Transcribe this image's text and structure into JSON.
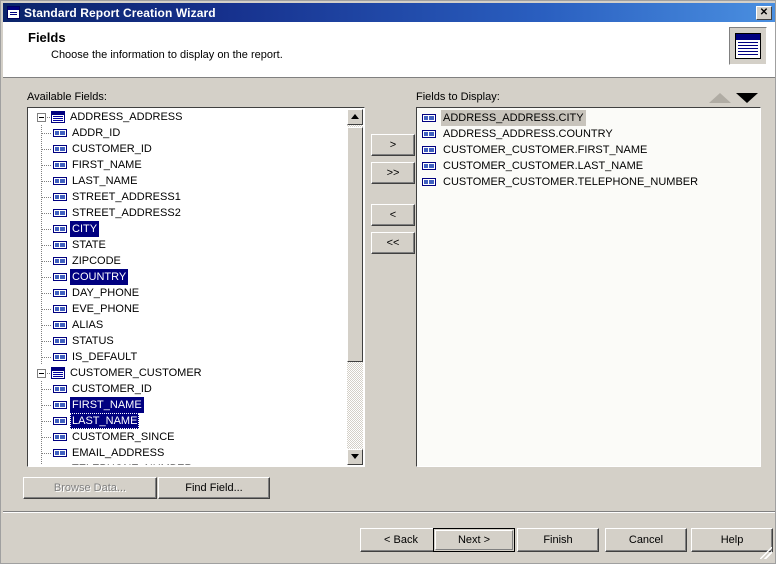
{
  "window": {
    "title": "Standard Report Creation Wizard",
    "icon": "report-wizard-icon",
    "close_label": "✕"
  },
  "header": {
    "title": "Fields",
    "subtitle": "Choose the information to display on the report.",
    "icon": "fields-page-icon"
  },
  "panels": {
    "available_label": "Available Fields:",
    "display_label": "Fields to Display:"
  },
  "sort": {
    "up_icon": "sort-up-arrow",
    "down_icon": "sort-down-arrow"
  },
  "tree": [
    {
      "type": "table",
      "label": "ADDRESS_ADDRESS",
      "selected": false
    },
    {
      "type": "field",
      "label": "ADDR_ID",
      "selected": false
    },
    {
      "type": "field",
      "label": "CUSTOMER_ID",
      "selected": false
    },
    {
      "type": "field",
      "label": "FIRST_NAME",
      "selected": false
    },
    {
      "type": "field",
      "label": "LAST_NAME",
      "selected": false
    },
    {
      "type": "field",
      "label": "STREET_ADDRESS1",
      "selected": false
    },
    {
      "type": "field",
      "label": "STREET_ADDRESS2",
      "selected": false
    },
    {
      "type": "field",
      "label": "CITY",
      "selected": true
    },
    {
      "type": "field",
      "label": "STATE",
      "selected": false
    },
    {
      "type": "field",
      "label": "ZIPCODE",
      "selected": false
    },
    {
      "type": "field",
      "label": "COUNTRY",
      "selected": true
    },
    {
      "type": "field",
      "label": "DAY_PHONE",
      "selected": false
    },
    {
      "type": "field",
      "label": "EVE_PHONE",
      "selected": false
    },
    {
      "type": "field",
      "label": "ALIAS",
      "selected": false
    },
    {
      "type": "field",
      "label": "STATUS",
      "selected": false
    },
    {
      "type": "field",
      "label": "IS_DEFAULT",
      "selected": false
    },
    {
      "type": "table",
      "label": "CUSTOMER_CUSTOMER",
      "selected": false
    },
    {
      "type": "field",
      "label": "CUSTOMER_ID",
      "selected": false
    },
    {
      "type": "field",
      "label": "FIRST_NAME",
      "selected": true
    },
    {
      "type": "field",
      "label": "LAST_NAME",
      "selected": true,
      "focus": true
    },
    {
      "type": "field",
      "label": "CUSTOMER_SINCE",
      "selected": false
    },
    {
      "type": "field",
      "label": "EMAIL_ADDRESS",
      "selected": false
    },
    {
      "type": "field",
      "label": "TELEPHONE_NUMBER",
      "selected": false
    }
  ],
  "transfer_buttons": [
    {
      "label": ">",
      "name": "add-field-button"
    },
    {
      "label": ">>",
      "name": "add-all-fields-button"
    },
    {
      "label": "<",
      "name": "remove-field-button"
    },
    {
      "label": "<<",
      "name": "remove-all-fields-button"
    }
  ],
  "display_fields": [
    {
      "label": "ADDRESS_ADDRESS.CITY",
      "selected": true
    },
    {
      "label": "ADDRESS_ADDRESS.COUNTRY",
      "selected": false
    },
    {
      "label": "CUSTOMER_CUSTOMER.FIRST_NAME",
      "selected": false
    },
    {
      "label": "CUSTOMER_CUSTOMER.LAST_NAME",
      "selected": false
    },
    {
      "label": "CUSTOMER_CUSTOMER.TELEPHONE_NUMBER",
      "selected": false
    }
  ],
  "tool_buttons": {
    "browse_data": "Browse Data...",
    "browse_data_enabled": false,
    "find_field": "Find Field..."
  },
  "footer_buttons": {
    "back": "< Back",
    "next": "Next >",
    "finish": "Finish",
    "cancel": "Cancel",
    "help": "Help"
  },
  "colors": {
    "title_start": "#0a246a",
    "title_end": "#4a8fe0",
    "face": "#d4d0c8",
    "selection": "#000080",
    "selection_inactive": "#c8c4bc",
    "field_icon": "#000080"
  }
}
